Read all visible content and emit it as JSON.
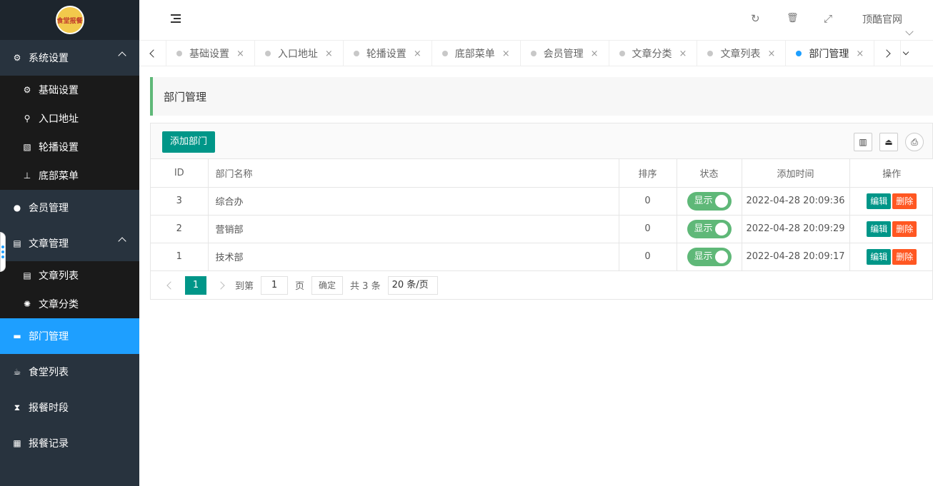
{
  "logo": {
    "text": "食堂报餐"
  },
  "sidebar": {
    "groups": [
      {
        "label": "系统设置",
        "icon": "gears-icon",
        "glyph": "⚙",
        "expanded": true,
        "children": [
          {
            "label": "基础设置",
            "icon": "gear-icon",
            "glyph": "⚙"
          },
          {
            "label": "入口地址",
            "icon": "search-icon",
            "glyph": "⚲"
          },
          {
            "label": "轮播设置",
            "icon": "image-icon",
            "glyph": "▧"
          },
          {
            "label": "底部菜单",
            "icon": "sitemap-icon",
            "glyph": "⊥"
          }
        ]
      },
      {
        "label": "会员管理",
        "icon": "user-icon",
        "glyph": "●"
      },
      {
        "label": "文章管理",
        "icon": "newspaper-icon",
        "glyph": "▤",
        "expanded": true,
        "children": [
          {
            "label": "文章列表",
            "icon": "newspaper-icon",
            "glyph": "▤"
          },
          {
            "label": "文章分类",
            "icon": "certificate-icon",
            "glyph": "✺"
          }
        ]
      },
      {
        "label": "部门管理",
        "icon": "server-icon",
        "glyph": "▬",
        "active": true
      },
      {
        "label": "食堂列表",
        "icon": "coffee-icon",
        "glyph": "☕"
      },
      {
        "label": "报餐时段",
        "icon": "hourglass-icon",
        "glyph": "⧗"
      },
      {
        "label": "报餐记录",
        "icon": "table-icon",
        "glyph": "▦"
      }
    ]
  },
  "header": {
    "refresh_glyph": "↻",
    "clear_glyph": "🗑",
    "fullscreen_glyph": "⤢",
    "site_link": "顶酷官网",
    "more_glyph": "⋮"
  },
  "tabs": [
    {
      "label": "基础设置",
      "active": false
    },
    {
      "label": "入口地址",
      "active": false
    },
    {
      "label": "轮播设置",
      "active": false
    },
    {
      "label": "底部菜单",
      "active": false
    },
    {
      "label": "会员管理",
      "active": false
    },
    {
      "label": "文章分类",
      "active": false
    },
    {
      "label": "文章列表",
      "active": false
    },
    {
      "label": "部门管理",
      "active": true
    }
  ],
  "tab_close": "×",
  "page_title": "部门管理",
  "toolbar": {
    "add_label": "添加部门",
    "columns_glyph": "▥",
    "export_glyph": "⏏",
    "print_glyph": "⎙"
  },
  "table": {
    "headers": {
      "id": "ID",
      "name": "部门名称",
      "sort": "排序",
      "status": "状态",
      "time": "添加时间",
      "ops": "操作"
    },
    "rows": [
      {
        "id": "3",
        "name": "综合办",
        "sort": "0",
        "status": "显示",
        "time": "2022-04-28 20:09:36"
      },
      {
        "id": "2",
        "name": "营销部",
        "sort": "0",
        "status": "显示",
        "time": "2022-04-28 20:09:29"
      },
      {
        "id": "1",
        "name": "技术部",
        "sort": "0",
        "status": "显示",
        "time": "2022-04-28 20:09:17"
      }
    ],
    "edit_label": "编辑",
    "delete_label": "删除"
  },
  "pager": {
    "current": "1",
    "goto_label": "到第",
    "goto_value": "1",
    "page_label": "页",
    "confirm_label": "确定",
    "total_label": "共 3 条",
    "page_size": "20 条/页"
  },
  "colors": {
    "sidebar": "#28333e",
    "active": "#1e9fff",
    "primary": "#009688",
    "danger": "#ff5722",
    "switch_on": "#5fb878"
  }
}
